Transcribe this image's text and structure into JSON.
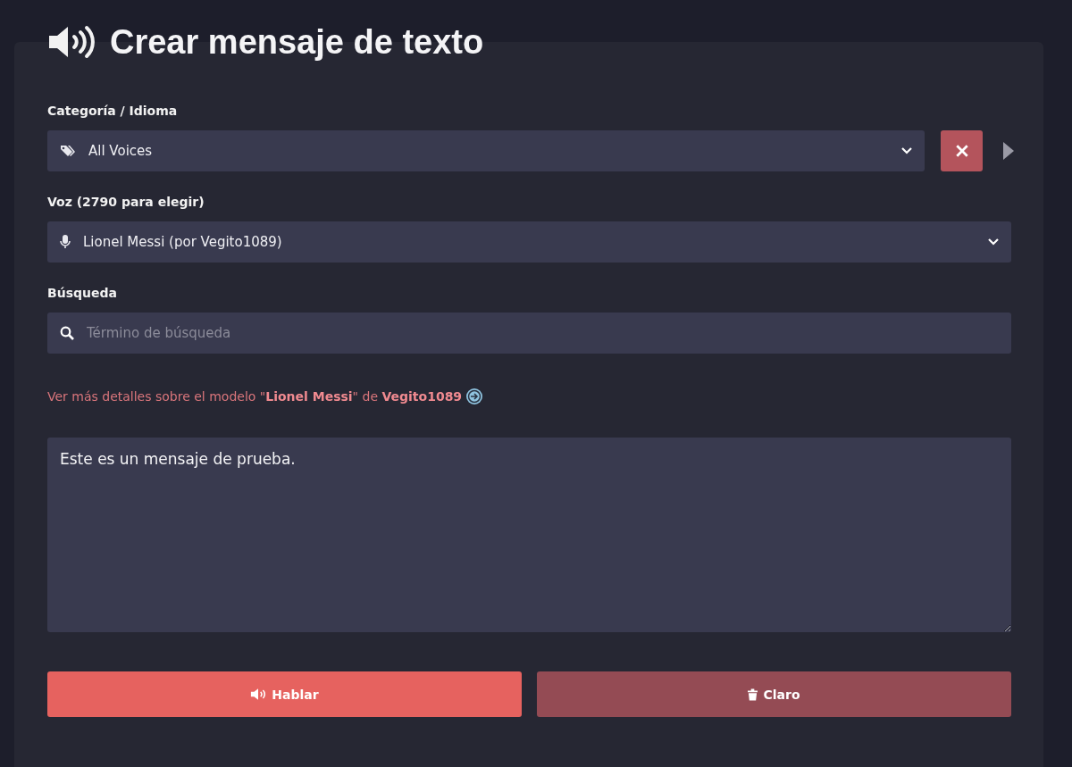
{
  "title": "Crear mensaje de texto",
  "category": {
    "label": "Categoría / Idioma",
    "value": "All Voices"
  },
  "voice": {
    "label": "Voz (2790 para elegir)",
    "value": "Lionel Messi (por Vegito1089)"
  },
  "search": {
    "label": "Búsqueda",
    "placeholder": "Término de búsqueda"
  },
  "details_link": "Ver más detalles sobre el modelo \"**Lionel Messi**\" de **Vegito1089**",
  "message": "Este es un mensaje de prueba.",
  "buttons": [
    {
      "label": "Hablar",
      "kind": "speak"
    },
    {
      "label": "Claro",
      "kind": "clear"
    }
  ]
}
